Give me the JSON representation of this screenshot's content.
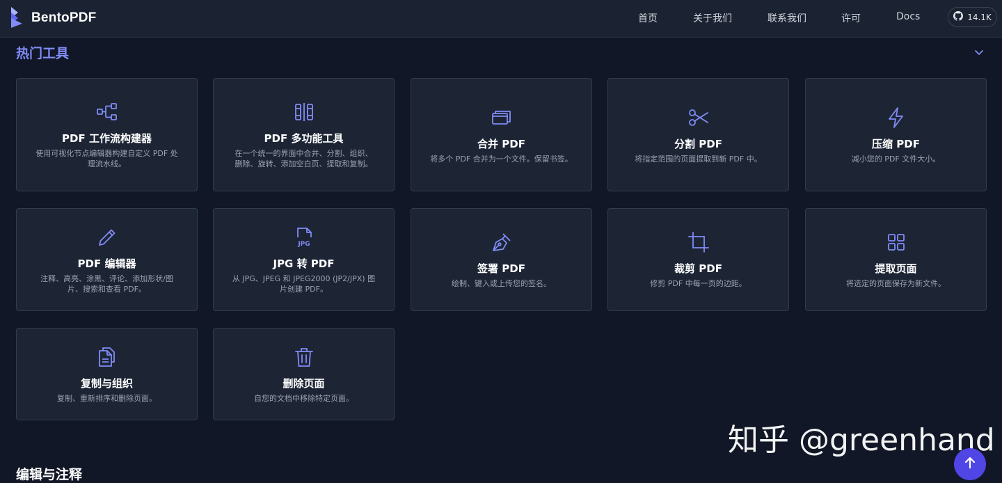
{
  "brand": {
    "name": "BentoPDF",
    "accent": "#818cf8"
  },
  "nav": {
    "items": [
      {
        "label": "首页"
      },
      {
        "label": "关于我们"
      },
      {
        "label": "联系我们"
      },
      {
        "label": "许可"
      },
      {
        "label": "Docs"
      }
    ],
    "github_stars": "14.1K"
  },
  "sections": {
    "hot_tools": {
      "title": "热门工具"
    },
    "edit_annotate": {
      "title": "编辑与注释"
    }
  },
  "cards": [
    {
      "icon": "workflow-icon",
      "title": "PDF 工作流构建器",
      "desc": "使用可视化节点编辑器构建自定义 PDF 处理流水线。"
    },
    {
      "icon": "multi-tool-icon",
      "title": "PDF 多功能工具",
      "desc": "在一个统一的界面中合并、分割、组织、删除、旋转、添加空白页、提取和复制。"
    },
    {
      "icon": "merge-icon",
      "title": "合并 PDF",
      "desc": "将多个 PDF 合并为一个文件。保留书签。"
    },
    {
      "icon": "scissors-icon",
      "title": "分割 PDF",
      "desc": "将指定范围的页面提取到新 PDF 中。"
    },
    {
      "icon": "lightning-icon",
      "title": "压缩 PDF",
      "desc": "减小您的 PDF 文件大小。"
    },
    {
      "icon": "pencil-icon",
      "title": "PDF 编辑器",
      "desc": "注释、高亮、涂黑、评论、添加形状/图片、搜索和查看 PDF。"
    },
    {
      "icon": "jpg-file-icon",
      "title": "JPG 转 PDF",
      "desc": "从 JPG、JPEG 和 JPEG2000 (JP2/JPX) 图片创建 PDF。"
    },
    {
      "icon": "pen-nib-icon",
      "title": "签署 PDF",
      "desc": "绘制、键入或上传您的签名。"
    },
    {
      "icon": "crop-icon",
      "title": "裁剪 PDF",
      "desc": "修剪 PDF 中每一页的边距。"
    },
    {
      "icon": "grid-icon",
      "title": "提取页面",
      "desc": "将选定的页面保存为新文件。"
    },
    {
      "icon": "copy-files-icon",
      "title": "复制与组织",
      "desc": "复制、重新排序和删除页面。"
    },
    {
      "icon": "trash-icon",
      "title": "删除页面",
      "desc": "自您的文档中移除特定页面。"
    }
  ],
  "watermark": "知乎 @greenhand"
}
